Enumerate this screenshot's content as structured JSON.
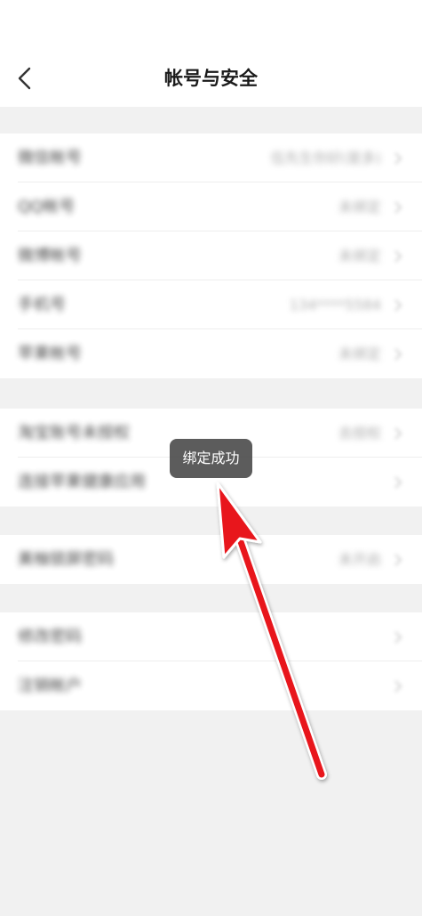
{
  "navbar": {
    "title": "帐号与安全"
  },
  "groups": [
    {
      "rows": [
        {
          "label": "微信帐号",
          "value": "伍先生你好(是多)"
        },
        {
          "label": "QQ帐号",
          "value": "未绑定"
        },
        {
          "label": "微博帐号",
          "value": "未绑定"
        },
        {
          "label": "手机号",
          "value": "134****5584"
        },
        {
          "label": "苹果帐号",
          "value": "未绑定"
        }
      ]
    },
    {
      "rows": [
        {
          "label": "淘宝账号未授权",
          "value": "去授权"
        },
        {
          "label": "连接苹果健康应用",
          "value": ""
        }
      ]
    },
    {
      "rows": [
        {
          "label": "美柚锁屏密码",
          "value": "未开启"
        }
      ]
    },
    {
      "rows": [
        {
          "label": "修改密码",
          "value": ""
        },
        {
          "label": "注销帐户",
          "value": ""
        }
      ]
    }
  ],
  "toast": {
    "text": "绑定成功"
  },
  "colors": {
    "background": "#f1f1f1",
    "card": "#ffffff",
    "toast_bg": "#464646",
    "annotation_arrow": "#e8141b"
  },
  "icons": {
    "back": "chevron-left-icon",
    "row_arrow": "chevron-right-icon",
    "annotation": "red-arrow-annotation"
  }
}
